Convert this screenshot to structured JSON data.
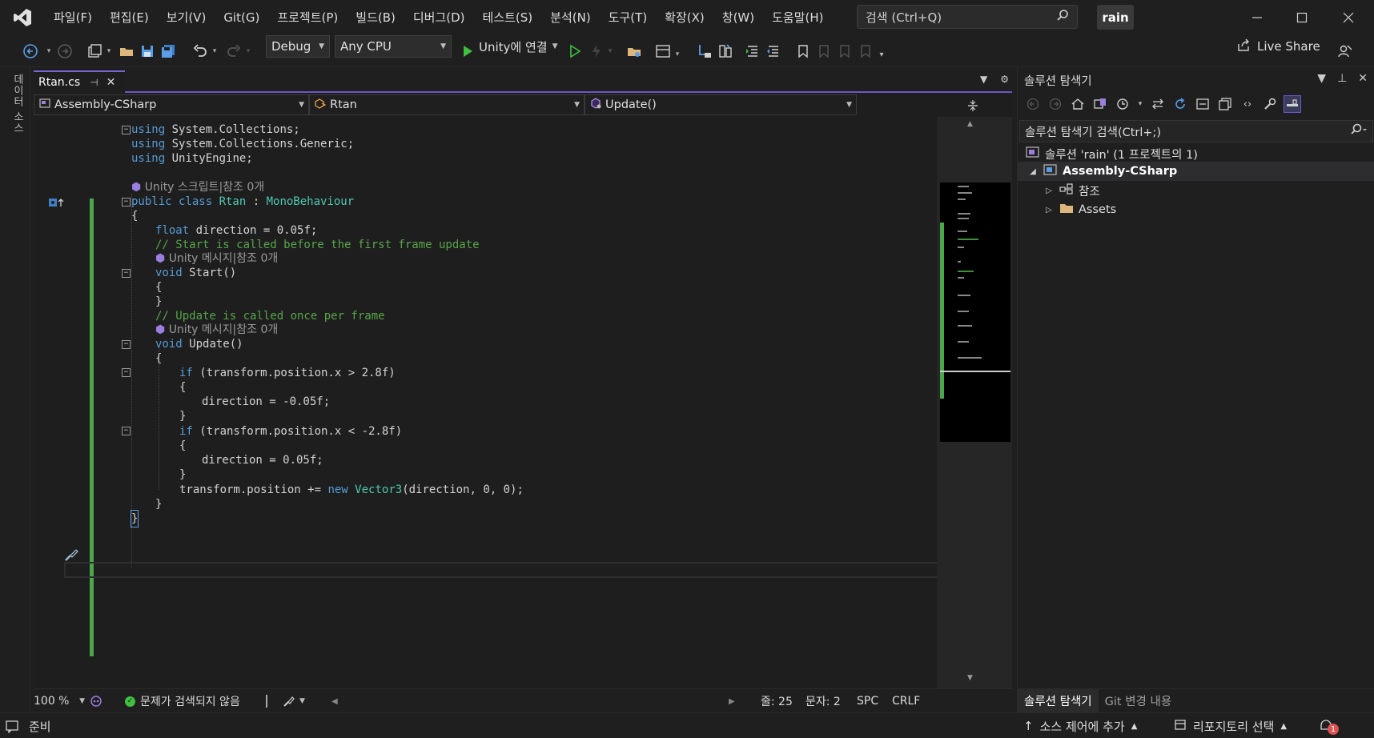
{
  "menu": [
    "파일(F)",
    "편집(E)",
    "보기(V)",
    "Git(G)",
    "프로젝트(P)",
    "빌드(B)",
    "디버그(D)",
    "테스트(S)",
    "분석(N)",
    "도구(T)",
    "확장(X)",
    "창(W)",
    "도움말(H)"
  ],
  "search": {
    "placeholder": "검색 (Ctrl+Q)"
  },
  "profile": "rain",
  "toolbar": {
    "config": "Debug",
    "platform": "Any CPU",
    "run_target": "Unity에 연결",
    "live_share": "Live Share"
  },
  "left_strip": {
    "label": "데이터 소스"
  },
  "tab": {
    "file": "Rtan.cs"
  },
  "navbar": {
    "project": "Assembly-CSharp",
    "type": "Rtan",
    "member": "Update()"
  },
  "code": {
    "l1_kw": "using",
    "l1_rest": " System.Collections;",
    "l2_kw": "using",
    "l2_rest": " System.Collections.Generic;",
    "l3_kw": "using",
    "l3_rest": " UnityEngine;",
    "hint_class": "Unity 스크립트|참조 0개",
    "l5_kw": "public class ",
    "l5_type": "Rtan",
    "l5_sep": " : ",
    "l5_base": "MonoBehaviour",
    "l6": "{",
    "l7_kw": "float",
    "l7_rest": " direction = 0.05f;",
    "l8": "// Start is called before the first frame update",
    "hint_start": "Unity 메시지|참조 0개",
    "l9_kw": "void ",
    "l9_rest": "Start()",
    "l10": "{",
    "l11": "}",
    "l12": "// Update is called once per frame",
    "hint_update": "Unity 메시지|참조 0개",
    "l13_kw": "void ",
    "l13_rest": "Update()",
    "l14": "{",
    "l15_kw": "if",
    "l15_rest": " (transform.position.x > 2.8f)",
    "l16": "{",
    "l17": "direction = -0.05f;",
    "l18": "}",
    "l19_kw": "if",
    "l19_rest": " (transform.position.x < -2.8f)",
    "l20": "{",
    "l21": "direction = 0.05f;",
    "l22": "}",
    "l23_a": "transform.position += ",
    "l23_kw": "new",
    "l23_sp": " ",
    "l23_type": "Vector3",
    "l23_rest": "(direction, 0, 0);",
    "l24": "}",
    "l25": "}"
  },
  "editor_status": {
    "zoom": "100 %",
    "issues": "문제가 검색되지 않음",
    "line": "줄: 25",
    "col": "문자: 2",
    "whitespace": "SPC",
    "eol": "CRLF"
  },
  "solution": {
    "title": "솔루션 탐색기",
    "search_placeholder": "솔루션 탐색기 검색(Ctrl+;)",
    "root": "솔루션 'rain' (1 프로젝트의 1)",
    "project": "Assembly-CSharp",
    "refs": "참조",
    "assets": "Assets",
    "tab_active": "솔루션 탐색기",
    "tab_inactive": "Git 변경 내용"
  },
  "statusbar": {
    "ready": "준비",
    "source_control": "소스 제어에 추가",
    "repo": "리포지토리 선택",
    "notifications": "1"
  },
  "colors": {
    "accent": "#6d57c6",
    "keyword": "#569cd6",
    "type": "#4ec9b0",
    "comment": "#57a64a",
    "change_bar": "#4ca64c"
  }
}
